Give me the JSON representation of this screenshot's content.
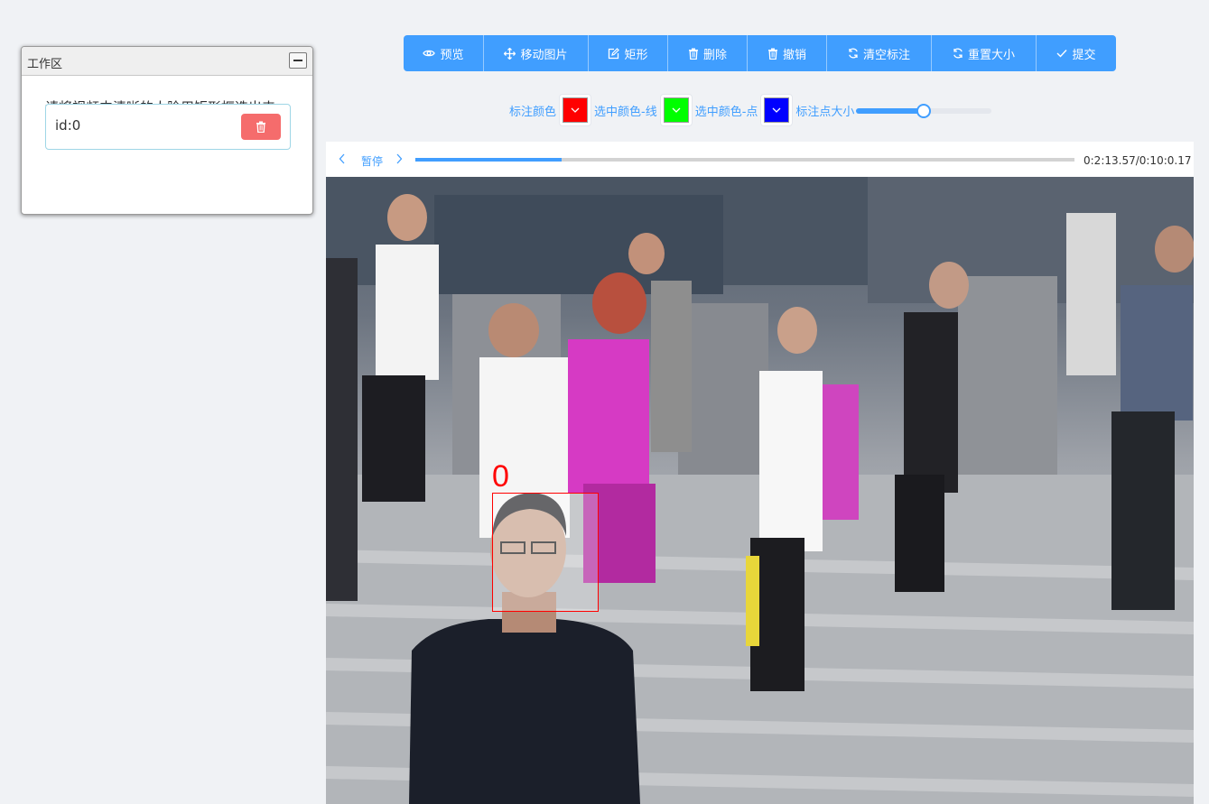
{
  "workspace": {
    "title": "工作区",
    "instruction": "请将视频中清晰的人脸用矩形框选出来",
    "items": [
      {
        "label": "id:0"
      }
    ]
  },
  "toolbar": {
    "buttons": [
      {
        "label": "预览",
        "icon": "eye-icon"
      },
      {
        "label": "移动图片",
        "icon": "move-icon"
      },
      {
        "label": "矩形",
        "icon": "edit-square-icon"
      },
      {
        "label": "删除",
        "icon": "trash-icon"
      },
      {
        "label": "撤销",
        "icon": "trash-icon"
      },
      {
        "label": "清空标注",
        "icon": "refresh-icon"
      },
      {
        "label": "重置大小",
        "icon": "refresh-icon"
      },
      {
        "label": "提交",
        "icon": "check-icon"
      }
    ]
  },
  "colors": {
    "annotation_label": "标注颜色",
    "annotation_color": "#ff0000",
    "selected_line_label": "选中颜色-线",
    "selected_line_color": "#00ff00",
    "selected_point_label": "选中颜色-点",
    "selected_point_color": "#0000ff",
    "point_size_label": "标注点大小",
    "point_size_fraction": 0.5
  },
  "player": {
    "pause_label": "暂停",
    "time": "0:2:13.57/0:10:0.17",
    "progress_fraction": 0.222
  },
  "annotation": {
    "label": "0",
    "color": "#ff0000"
  }
}
